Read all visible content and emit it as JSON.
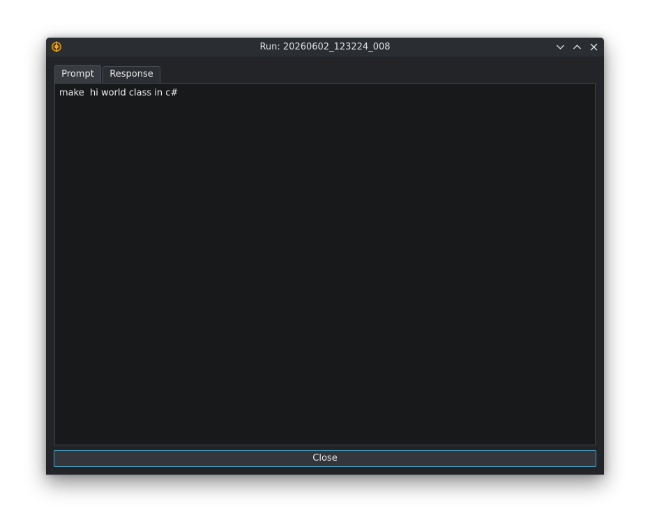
{
  "window": {
    "title": "Run: 20260602_123224_008",
    "icons": {
      "app": "app-logo-icon",
      "minimize": "chevron-down-icon",
      "maximize": "chevron-up-icon",
      "close": "close-icon"
    }
  },
  "tabs": [
    {
      "label": "Prompt",
      "active": true
    },
    {
      "label": "Response",
      "active": false
    }
  ],
  "prompt": {
    "text": "make  hi world class in c#"
  },
  "footer": {
    "close_label": "Close"
  },
  "colors": {
    "window_bg": "#222428",
    "titlebar_bg": "#2a2d31",
    "content_bg": "#18191b",
    "focus_accent": "#4aa3c8",
    "icon_accent": "#e8a31d"
  }
}
